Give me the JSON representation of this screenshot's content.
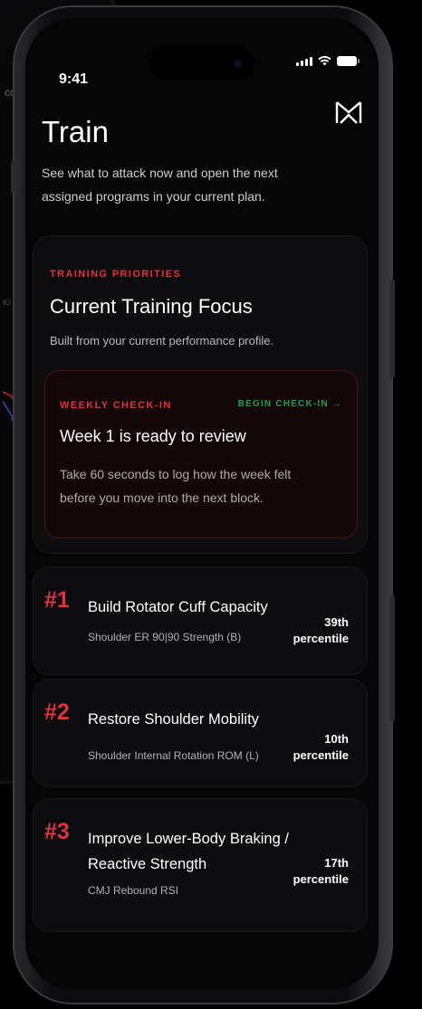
{
  "status": {
    "time": "9:41"
  },
  "header": {
    "title": "Train",
    "subtitle": "See what to attack now and open the next assigned programs in your current plan."
  },
  "priorities_card": {
    "eyebrow": "TRAINING PRIORITIES",
    "title": "Current Training Focus",
    "subtitle": "Built from your current performance profile.",
    "checkin": {
      "eyebrow": "WEEKLY CHECK-IN",
      "action": "BEGIN CHECK-IN →",
      "title": "Week 1 is ready to review",
      "body": "Take 60 seconds to log how the week felt before you move into the next block."
    }
  },
  "priorities": [
    {
      "rank": "#1",
      "title": "Build Rotator Cuff Capacity",
      "metric": "Shoulder ER 90|90 Strength (B)",
      "percentile": "39th",
      "percentile_label": "percentile"
    },
    {
      "rank": "#2",
      "title": "Restore Shoulder Mobility",
      "metric": "Shoulder Internal Rotation ROM (L)",
      "percentile": "10th",
      "percentile_label": "percentile"
    },
    {
      "rank": "#3",
      "title": "Improve Lower-Body Braking / Reactive Strength",
      "metric": "CMJ Rebound RSI",
      "percentile": "17th",
      "percentile_label": "percentile"
    }
  ],
  "background_device": {
    "label": "co",
    "tick_label": "Ю"
  },
  "colors": {
    "accent_red": "#e0323c",
    "accent_green": "#1aa34a",
    "background": "#050506",
    "card": "#0d0d10"
  },
  "icons": {
    "logo": "m-monogram-logo",
    "signal": "cellular-signal-icon",
    "wifi": "wifi-icon",
    "battery": "battery-icon"
  }
}
